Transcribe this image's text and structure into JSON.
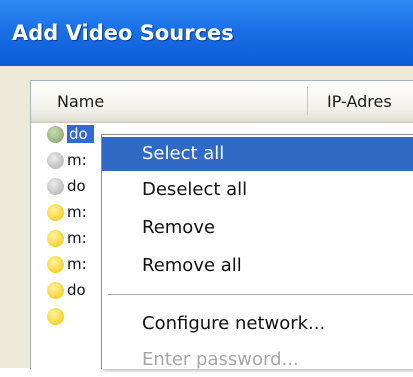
{
  "window": {
    "title": "Add Video Sources"
  },
  "list": {
    "columns": {
      "name": "Name",
      "ip": "IP-Adres"
    },
    "rows": [
      {
        "status": "green",
        "name": "do",
        "selected": true
      },
      {
        "status": "gray",
        "name": "m:"
      },
      {
        "status": "gray",
        "name": "do"
      },
      {
        "status": "yellow",
        "name": "m:"
      },
      {
        "status": "yellow",
        "name": "m:"
      },
      {
        "status": "yellow",
        "name": "m:"
      },
      {
        "status": "yellow",
        "name": "do"
      },
      {
        "status": "yellow",
        "name": ""
      }
    ]
  },
  "context_menu": {
    "items": [
      {
        "label": "Select all",
        "state": "highlighted"
      },
      {
        "label": "Deselect all"
      },
      {
        "label": "Remove"
      },
      {
        "label": "Remove all"
      },
      {
        "label": "Configure network..."
      },
      {
        "label": "Enter password...",
        "state": "disabled"
      }
    ]
  },
  "colors": {
    "titlebar": "#0b5bd8",
    "selection": "#316ac5",
    "status_green": "#7f9c66",
    "status_gray": "#a9a9a9",
    "status_yellow": "#f2c400"
  }
}
